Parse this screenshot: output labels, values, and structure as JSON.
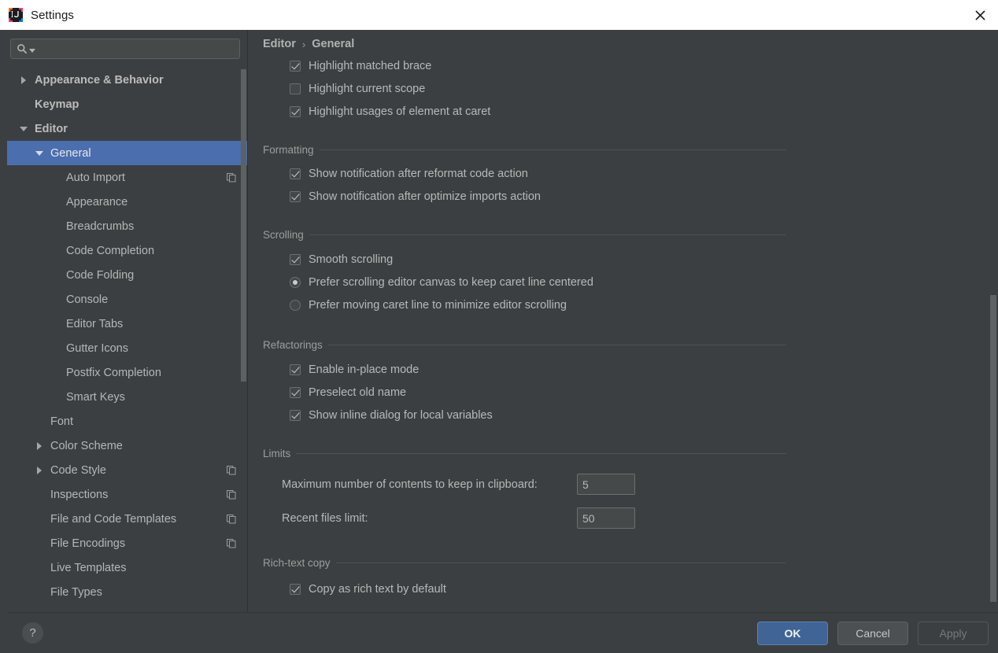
{
  "window": {
    "title": "Settings",
    "app_icon": "intellij-idea-logo",
    "close_icon": "close-icon"
  },
  "search": {
    "value": "",
    "placeholder": "",
    "icon": "search-icon",
    "dropdown_icon": "chevron-down-icon"
  },
  "sidebar": {
    "scrollbar": "vertical-scrollbar",
    "items": [
      {
        "label": "Appearance & Behavior",
        "indent": 0,
        "twisty": "right",
        "bold": true,
        "selected": false,
        "copy": false
      },
      {
        "label": "Keymap",
        "indent": 0,
        "twisty": "none",
        "bold": true,
        "selected": false,
        "copy": false
      },
      {
        "label": "Editor",
        "indent": 0,
        "twisty": "down",
        "bold": true,
        "selected": false,
        "copy": false
      },
      {
        "label": "General",
        "indent": 1,
        "twisty": "down",
        "bold": false,
        "selected": true,
        "copy": false
      },
      {
        "label": "Auto Import",
        "indent": 2,
        "twisty": "none",
        "bold": false,
        "selected": false,
        "copy": true
      },
      {
        "label": "Appearance",
        "indent": 2,
        "twisty": "none",
        "bold": false,
        "selected": false,
        "copy": false
      },
      {
        "label": "Breadcrumbs",
        "indent": 2,
        "twisty": "none",
        "bold": false,
        "selected": false,
        "copy": false
      },
      {
        "label": "Code Completion",
        "indent": 2,
        "twisty": "none",
        "bold": false,
        "selected": false,
        "copy": false
      },
      {
        "label": "Code Folding",
        "indent": 2,
        "twisty": "none",
        "bold": false,
        "selected": false,
        "copy": false
      },
      {
        "label": "Console",
        "indent": 2,
        "twisty": "none",
        "bold": false,
        "selected": false,
        "copy": false
      },
      {
        "label": "Editor Tabs",
        "indent": 2,
        "twisty": "none",
        "bold": false,
        "selected": false,
        "copy": false
      },
      {
        "label": "Gutter Icons",
        "indent": 2,
        "twisty": "none",
        "bold": false,
        "selected": false,
        "copy": false
      },
      {
        "label": "Postfix Completion",
        "indent": 2,
        "twisty": "none",
        "bold": false,
        "selected": false,
        "copy": false
      },
      {
        "label": "Smart Keys",
        "indent": 2,
        "twisty": "none",
        "bold": false,
        "selected": false,
        "copy": false
      },
      {
        "label": "Font",
        "indent": 1,
        "twisty": "none",
        "bold": false,
        "selected": false,
        "copy": false
      },
      {
        "label": "Color Scheme",
        "indent": 1,
        "twisty": "right",
        "bold": false,
        "selected": false,
        "copy": false
      },
      {
        "label": "Code Style",
        "indent": 1,
        "twisty": "right",
        "bold": false,
        "selected": false,
        "copy": true
      },
      {
        "label": "Inspections",
        "indent": 1,
        "twisty": "none",
        "bold": false,
        "selected": false,
        "copy": true
      },
      {
        "label": "File and Code Templates",
        "indent": 1,
        "twisty": "none",
        "bold": false,
        "selected": false,
        "copy": true
      },
      {
        "label": "File Encodings",
        "indent": 1,
        "twisty": "none",
        "bold": false,
        "selected": false,
        "copy": true
      },
      {
        "label": "Live Templates",
        "indent": 1,
        "twisty": "none",
        "bold": false,
        "selected": false,
        "copy": false
      },
      {
        "label": "File Types",
        "indent": 1,
        "twisty": "none",
        "bold": false,
        "selected": false,
        "copy": false
      }
    ]
  },
  "main": {
    "breadcrumb": {
      "parent": "Editor",
      "separator": "›",
      "current": "General"
    },
    "top_options": [
      {
        "label": "Highlight matched brace",
        "checked": true
      },
      {
        "label": "Highlight current scope",
        "checked": false
      },
      {
        "label": "Highlight usages of element at caret",
        "checked": true
      }
    ],
    "sections": [
      {
        "title": "Formatting",
        "checkboxes": [
          {
            "label": "Show notification after reformat code action",
            "checked": true
          },
          {
            "label": "Show notification after optimize imports action",
            "checked": true
          }
        ]
      },
      {
        "title": "Scrolling",
        "checkboxes": [
          {
            "label": "Smooth scrolling",
            "checked": true
          }
        ],
        "radios": [
          {
            "label": "Prefer scrolling editor canvas to keep caret line centered",
            "selected": true
          },
          {
            "label": "Prefer moving caret line to minimize editor scrolling",
            "selected": false
          }
        ]
      },
      {
        "title": "Refactorings",
        "checkboxes": [
          {
            "label": "Enable in-place mode",
            "checked": true
          },
          {
            "label": "Preselect old name",
            "checked": true
          },
          {
            "label": "Show inline dialog for local variables",
            "checked": true
          }
        ]
      },
      {
        "title": "Limits",
        "fields": [
          {
            "label": "Maximum number of contents to keep in clipboard:",
            "value": "5"
          },
          {
            "label": "Recent files limit:",
            "value": "50"
          }
        ]
      },
      {
        "title": "Rich-text copy",
        "checkboxes": [
          {
            "label": "Copy as rich text by default",
            "checked": true
          }
        ]
      }
    ],
    "scrollbar": "vertical-scrollbar"
  },
  "footer": {
    "help_label": "?",
    "buttons": [
      {
        "label": "OK",
        "style": "primary"
      },
      {
        "label": "Cancel",
        "style": "normal"
      },
      {
        "label": "Apply",
        "style": "disabled"
      }
    ]
  },
  "colors": {
    "background": "#3c3f41",
    "selection": "#4b6eaf",
    "primary_button": "#3f6495",
    "text": "#b6b9ba",
    "titlebar": "#ffffff"
  }
}
